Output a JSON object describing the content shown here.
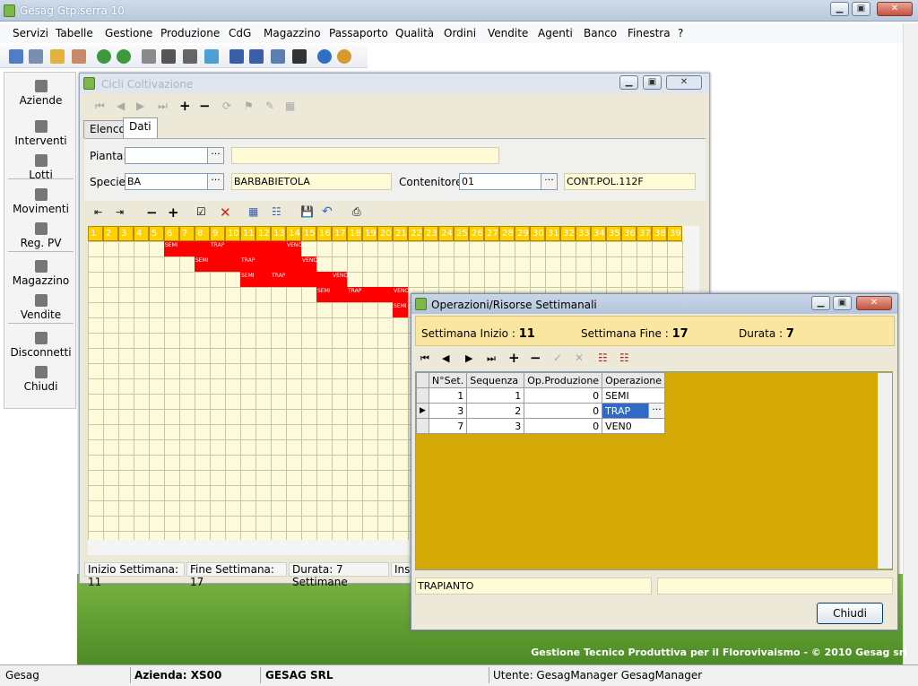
{
  "app": {
    "title": "Gesag Gtp.serra 10"
  },
  "menu": [
    "Servizi",
    "Tabelle",
    "Gestione",
    "Produzione",
    "CdG",
    "Magazzino",
    "Passaporto",
    "Qualità",
    "Ordini",
    "Vendite",
    "Agenti",
    "Banco",
    "Finestra",
    "?"
  ],
  "sidebar": [
    {
      "label": "Aziende",
      "icon": "flower-icon"
    },
    {
      "label": "Interventi",
      "icon": "hand-icon"
    },
    {
      "label": "Lotti",
      "icon": "pallet-icon"
    },
    {
      "label": "Movimenti",
      "icon": "gears-icon"
    },
    {
      "label": "Reg. PV",
      "icon": "register-icon"
    },
    {
      "label": "Magazzino",
      "icon": "warehouse-icon"
    },
    {
      "label": "Vendite",
      "icon": "calendar-icon"
    },
    {
      "label": "Disconnetti",
      "icon": "disconnect-icon"
    },
    {
      "label": "Chiudi",
      "icon": "door-icon"
    }
  ],
  "cicli": {
    "title": "Cicli Coltivazione",
    "tabs": [
      "Elenco",
      "Dati"
    ],
    "pianta_label": "Pianta:",
    "pianta_value": "",
    "pianta_desc": "",
    "specie_label": "Specie:",
    "specie_value": "BA",
    "specie_desc": "BARBABIETOLA",
    "contenitore_label": "Contenitore:",
    "contenitore_value": "01",
    "contenitore_desc": "CONT.POL.112F",
    "ellipsis": "···",
    "week_headers": [
      "1",
      "2",
      "3",
      "4",
      "5",
      "6",
      "7",
      "8",
      "9",
      "10",
      "11",
      "12",
      "13",
      "14",
      "15",
      "16",
      "17",
      "18",
      "19",
      "20",
      "21",
      "22",
      "23",
      "24",
      "25",
      "26",
      "27",
      "28",
      "29",
      "30",
      "31",
      "32",
      "33",
      "34",
      "35",
      "36",
      "37",
      "38",
      "39"
    ],
    "bars": [
      {
        "row": 0,
        "start": 6,
        "cells": [
          {
            "w": 6,
            "t": "SEMI"
          },
          {
            "w": 9,
            "t": "TRAP"
          },
          {
            "w": 14,
            "t": "VENO"
          }
        ],
        "end": 14
      },
      {
        "row": 1,
        "start": 8,
        "cells": [
          {
            "w": 8,
            "t": "SEMI"
          },
          {
            "w": 11,
            "t": "TRAP"
          },
          {
            "w": 15,
            "t": "VENO"
          }
        ],
        "end": 15
      },
      {
        "row": 2,
        "start": 11,
        "cells": [
          {
            "w": 11,
            "t": "SEMI"
          },
          {
            "w": 13,
            "t": "TRAP"
          },
          {
            "w": 17,
            "t": "VENO"
          }
        ],
        "end": 17
      },
      {
        "row": 3,
        "start": 16,
        "cells": [
          {
            "w": 16,
            "t": "SEMI"
          },
          {
            "w": 18,
            "t": "TRAP"
          },
          {
            "w": 21,
            "t": "VENO"
          }
        ],
        "end": 21
      },
      {
        "row": 4,
        "start": 21,
        "cells": [
          {
            "w": 21,
            "t": "SEMI"
          }
        ],
        "end": 21
      }
    ],
    "status": [
      "Inizio Settimana: 11",
      "Fine Settimana: 17",
      "Durata: 7 Settimane",
      "Inse"
    ]
  },
  "oper": {
    "title": "Operazioni/Risorse Settimanali",
    "inizio_label": "Settimana Inizio :",
    "inizio": "11",
    "fine_label": "Settimana Fine :",
    "fine": "17",
    "durata_label": "Durata :",
    "durata": "7",
    "columns": [
      "N°Set.",
      "Sequenza",
      "Op.Produzione",
      "Operazione"
    ],
    "rows": [
      {
        "nset": "1",
        "seq": "1",
        "op": "0",
        "oper": "SEMI"
      },
      {
        "nset": "3",
        "seq": "2",
        "op": "0",
        "oper": "TRAP"
      },
      {
        "nset": "7",
        "seq": "3",
        "op": "0",
        "oper": "VEN0"
      }
    ],
    "desc": "TRAPIANTO",
    "desc2": "",
    "chiudi": "Chiudi"
  },
  "footer": "Gestione Tecnico Produttiva per il Florovivaismo - © 2010 Gesag srl",
  "status": {
    "app": "Gesag",
    "azienda": "Azienda: XS00",
    "ditta": "GESAG SRL",
    "utente": "Utente: GesagManager GesagManager"
  }
}
